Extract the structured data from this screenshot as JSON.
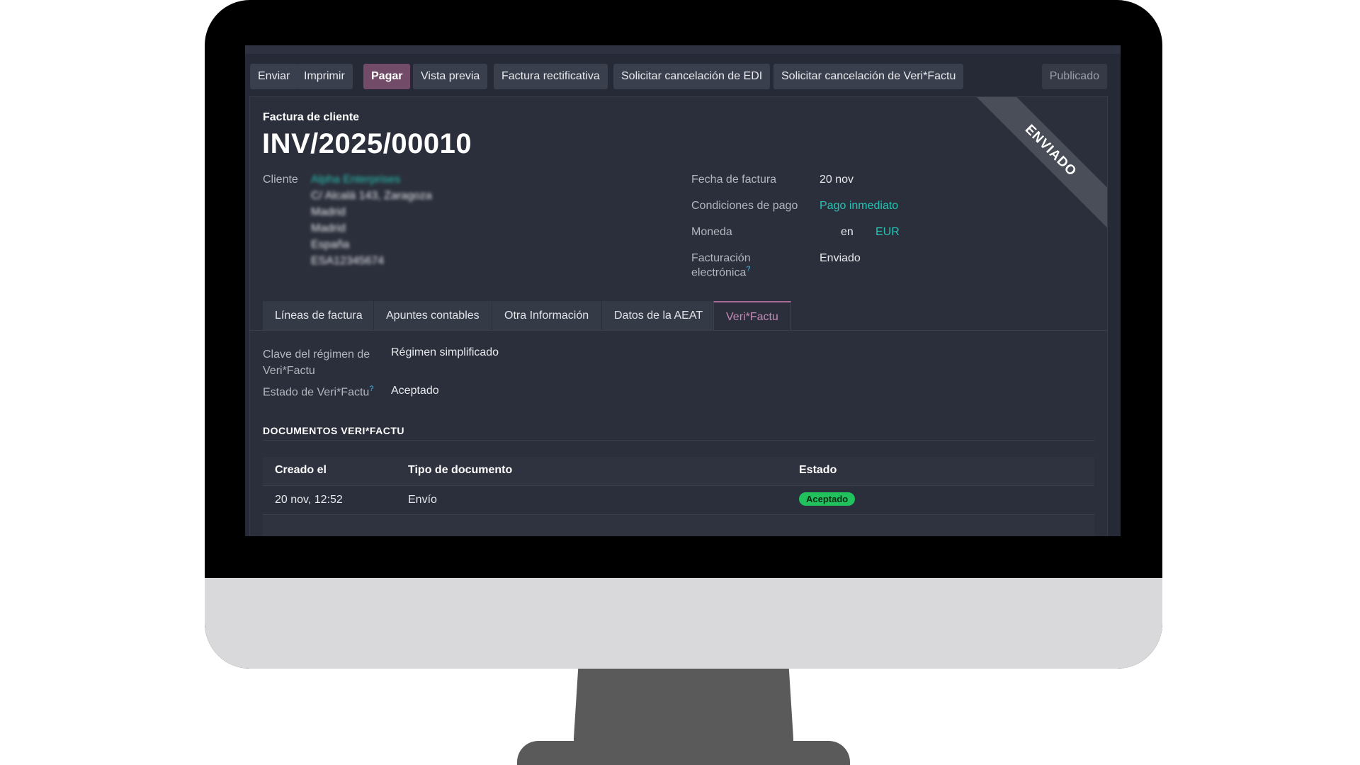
{
  "toolbar": {
    "buttons": [
      "Enviar",
      "Imprimir",
      "Pagar",
      "Vista previa",
      "Factura rectificativa",
      "Solicitar cancelación de EDI",
      "Solicitar cancelación de Veri*Factu"
    ],
    "status": "Publicado"
  },
  "invoice": {
    "type": "Factura de cliente",
    "number": "INV/2025/00010",
    "ribbon": "ENVIADO",
    "customer_label": "Cliente",
    "customer_name": "Alpha Enterprises",
    "address": [
      "C/ Alcalá 143, Zaragoza",
      "Madrid",
      "Madrid",
      "España",
      "ESA12345674"
    ]
  },
  "fields": {
    "invoice_date_label": "Fecha de factura",
    "invoice_date": "20 nov",
    "payment_terms_label": "Condiciones de pago",
    "payment_terms": "Pago inmediato",
    "currency_label": "Moneda",
    "currency_prefix": "en",
    "currency": "EUR",
    "einvoicing_label_1": "Facturación",
    "einvoicing_label_2": "electrónica",
    "einvoicing_help": "?",
    "einvoicing": "Enviado"
  },
  "tabs": [
    "Líneas de factura",
    "Apuntes contables",
    "Otra Información",
    "Datos de la AEAT",
    "Veri*Factu"
  ],
  "verifactu": {
    "regime_label_1": "Clave del régimen de",
    "regime_label_2": "Veri*Factu",
    "regime": "Régimen simplificado",
    "state_label": "Estado de Veri*Factu",
    "state_help": "?",
    "state": "Aceptado",
    "docs_title": "DOCUMENTOS VERI*FACTU",
    "columns": [
      "Creado el",
      "Tipo de documento",
      "Estado"
    ],
    "rows": [
      {
        "created": "20 nov, 12:52",
        "type": "Envío",
        "status": "Aceptado"
      }
    ]
  },
  "colors": {
    "accent": "#714b67",
    "link": "#27c2b3",
    "success": "#21c25e",
    "background": "#262a36"
  }
}
